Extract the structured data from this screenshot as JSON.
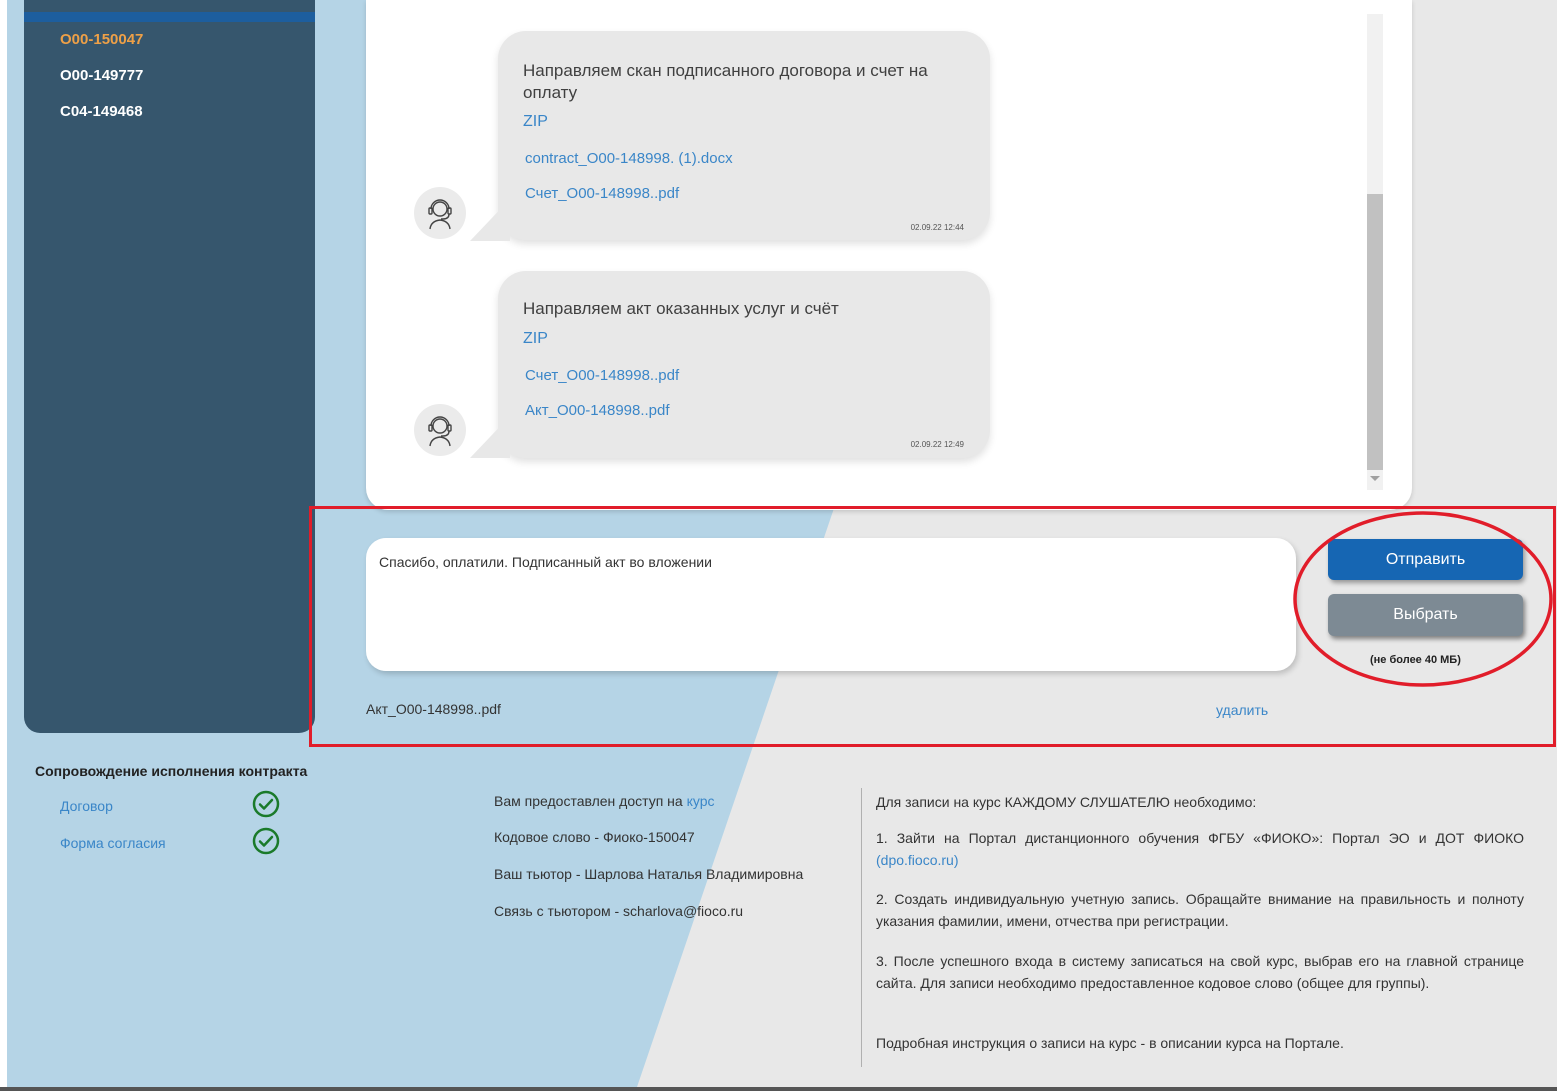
{
  "sidebar": {
    "items": [
      {
        "label": "О00-150047",
        "active": true
      },
      {
        "label": "О00-149777",
        "active": false
      },
      {
        "label": "С04-149468",
        "active": false
      }
    ]
  },
  "chat": {
    "messages": [
      {
        "text": "Направляем скан подписанного договора и счет на оплату",
        "zip_label": "ZIP",
        "attachments": [
          "contract_О00-148998. (1).docx",
          "Счет_О00-148998..pdf"
        ],
        "time": "02.09.22 12:44",
        "avatar_icon": "support-operator-icon"
      },
      {
        "text": "Направляем акт оказанных услуг и счёт",
        "zip_label": "ZIP",
        "attachments": [
          "Счет_О00-148998..pdf",
          "Акт_О00-148998..pdf"
        ],
        "time": "02.09.22 12:49",
        "avatar_icon": "support-operator-icon"
      }
    ]
  },
  "composer": {
    "input_value": "Спасибо, оплатили. Подписанный акт во вложении",
    "send_label": "Отправить",
    "choose_label": "Выбрать",
    "size_note": "(не более 40 МБ)",
    "attached_file": "Акт_О00-148998..pdf",
    "delete_label": "удалить"
  },
  "contract": {
    "title": "Сопровождение исполнения контракта",
    "items": [
      {
        "label": "Договор",
        "status_icon": "check-circle-icon"
      },
      {
        "label": "Форма согласия",
        "status_icon": "check-circle-icon"
      }
    ]
  },
  "access": {
    "access_prefix": "Вам предоставлен доступ на ",
    "access_link": "курс",
    "codeword": "Кодовое слово - Фиоко-150047",
    "tutor": "Ваш тьютор - Шарлова Наталья Владимировна",
    "contact": "Связь с тьютором - scharlova@fioco.ru"
  },
  "instructions": {
    "intro": "Для записи на курс КАЖДОМУ СЛУШАТЕЛЮ необходимо:",
    "step1_text": "1. Зайти на Портал дистанционного обучения ФГБУ «ФИОКО»: Портал ЭО и ДОТ ФИОКО ",
    "step1_link": "(dpo.fioco.ru)",
    "step2": "2. Создать индивидуальную учетную запись. Обращайте внимание на правильность и полноту указания фамилии, имени, отчества при регистрации.",
    "step3": "3. После успешного входа в систему записаться на свой курс, выбрав его на главной странице сайта. Для записи необходимо предоставленное кодовое слово (общее для группы).",
    "note": "Подробная инструкция о записи на курс - в описании курса на Портале."
  },
  "colors": {
    "accent_blue": "#1666b3",
    "link_blue": "#3a86c8",
    "sidebar_bg": "#36566d",
    "active_item": "#eea047",
    "check_green": "#1a7a2a",
    "annotation_red": "#e11d2a"
  }
}
